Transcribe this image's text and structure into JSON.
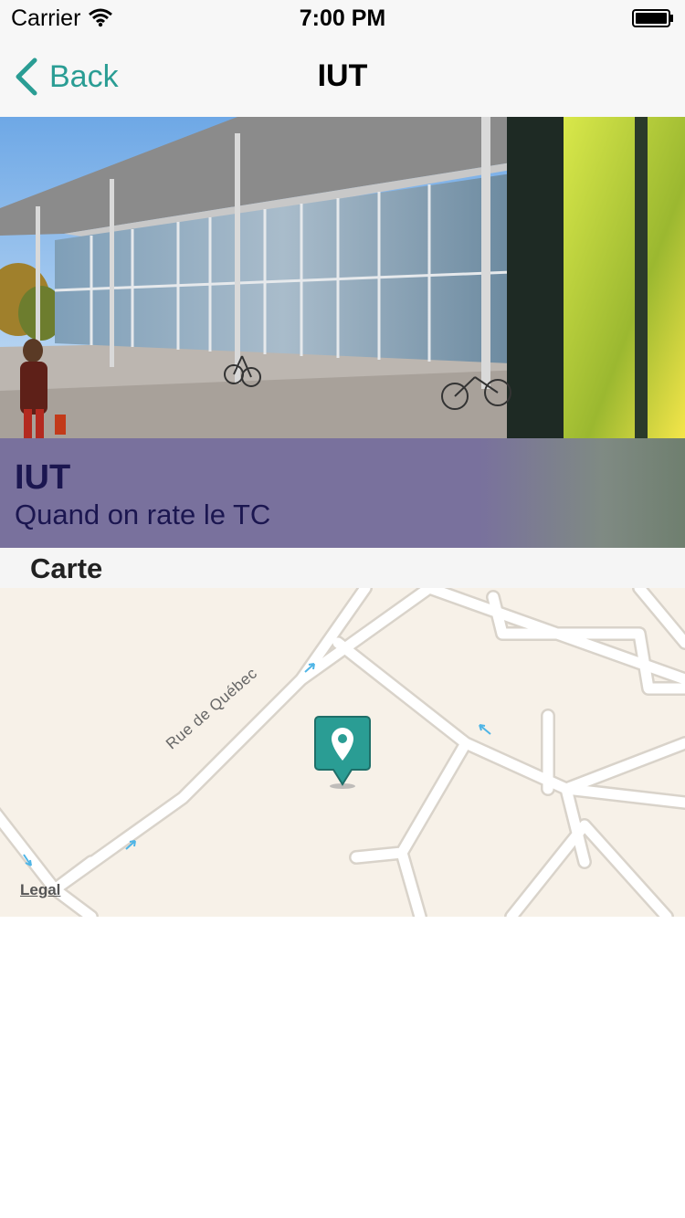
{
  "status_bar": {
    "carrier": "Carrier",
    "time": "7:00 PM",
    "icons": [
      "wifi-icon",
      "battery-icon"
    ]
  },
  "nav": {
    "back_label": "Back",
    "title": "IUT",
    "back_icon": "chevron-left-icon",
    "accent_color": "#2a9d94"
  },
  "hero": {
    "image": "photo of IUT glass building with bicycles and a pedestrian",
    "caption_title": "IUT",
    "caption_subtitle": "Quand on rate le TC",
    "caption_color": "#1b1650",
    "caption_background": "#79719d"
  },
  "map_section": {
    "header": "Carte",
    "street_label": "Rue de Québec",
    "legal_label": "Legal",
    "pin_icon": "map-pin-icon",
    "pin_color": "#2a9d94"
  }
}
